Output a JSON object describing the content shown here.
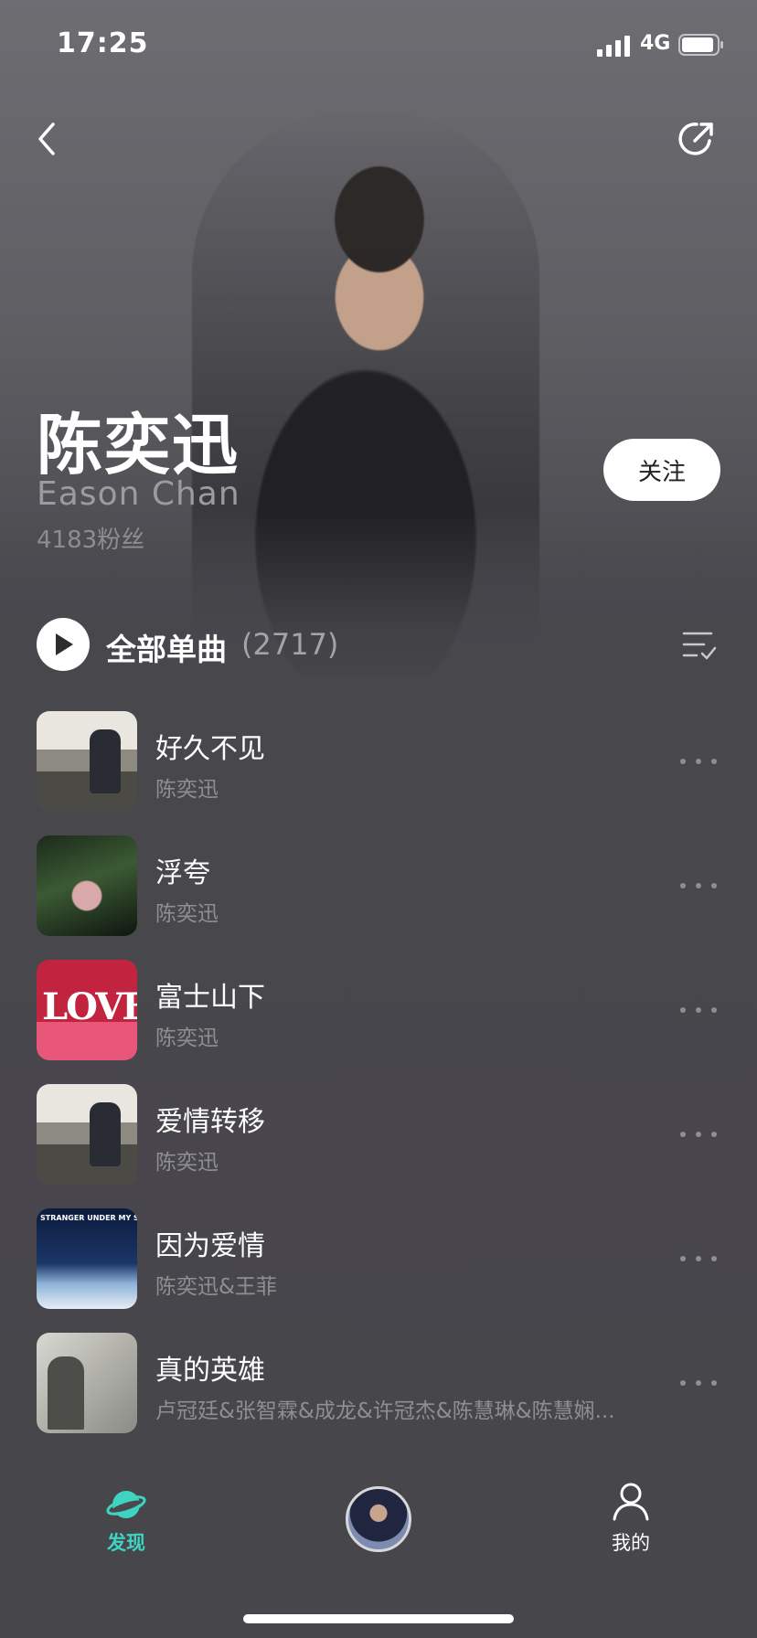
{
  "status_bar": {
    "time": "17:25",
    "network": "4G",
    "icons": [
      "signal-icon",
      "battery-icon"
    ]
  },
  "nav": {
    "icons": [
      "back-icon",
      "share-icon"
    ]
  },
  "artist": {
    "name_zh": "陈奕迅",
    "name_en": "Eason Chan",
    "fans": "4183粉丝",
    "follow_label": "关注"
  },
  "play_all": {
    "label": "全部单曲",
    "count": "(2717)",
    "icons": [
      "play-icon",
      "manage-list-icon"
    ]
  },
  "songs": [
    {
      "title": "好久不见",
      "artist": "陈奕迅"
    },
    {
      "title": "浮夸",
      "artist": "陈奕迅"
    },
    {
      "title": "富士山下",
      "artist": "陈奕迅"
    },
    {
      "title": "爱情转移",
      "artist": "陈奕迅"
    },
    {
      "title": "因为爱情",
      "artist": "陈奕迅&王菲"
    },
    {
      "title": "真的英雄",
      "artist": "卢冠廷&张智霖&成龙&许冠杰&陈慧琳&陈慧娴..."
    }
  ],
  "covers": {
    "love_text": "LOVE",
    "stranger_caption": "STRANGER UNDER MY SKIN"
  },
  "tab_bar": {
    "discover_label": "发现",
    "mine_label": "我的",
    "accent_color": "#3fd3c1",
    "icons": [
      "discover-planet-icon",
      "now-playing-disc",
      "user-icon"
    ]
  }
}
